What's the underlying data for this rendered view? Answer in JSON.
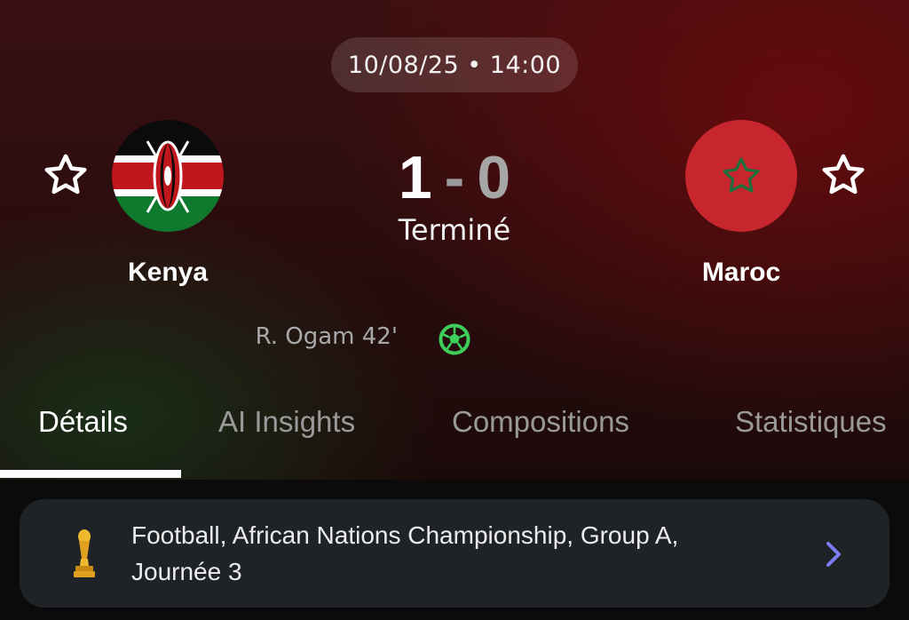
{
  "match": {
    "datetime": "10/08/25 • 14:00",
    "home": {
      "name": "Kenya",
      "score": "1",
      "flag_icon": "kenya-flag-icon"
    },
    "away": {
      "name": "Maroc",
      "score": "0",
      "flag_icon": "morocco-flag-icon"
    },
    "separator": "-",
    "status": "Terminé",
    "goals": [
      {
        "scorer": "R. Ogam 42'",
        "icon": "soccer-ball-icon",
        "icon_color": "#3ecf5a"
      }
    ]
  },
  "tabs": [
    {
      "label": "Détails",
      "active": true
    },
    {
      "label": "AI Insights",
      "active": false
    },
    {
      "label": "Compositions",
      "active": false
    },
    {
      "label": "Statistiques",
      "active": false
    }
  ],
  "competition": {
    "line1": "Football, African Nations Championship, Group A,",
    "line2": "Journée 3",
    "icon": "trophy-icon",
    "chevron_color": "#7b7ff0"
  },
  "colors": {
    "accent_green": "#3ecf5a",
    "tab_active": "#ffffff",
    "tab_inactive": "#9a9a9a"
  }
}
